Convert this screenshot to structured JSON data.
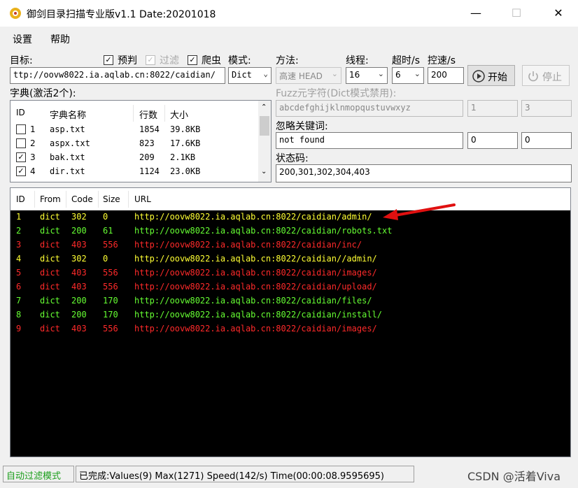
{
  "window": {
    "title": "御剑目录扫描专业版v1.1 Date:20201018",
    "minimize": "—",
    "maximize": "☐",
    "close": "✕"
  },
  "menu": [
    "设置",
    "帮助"
  ],
  "target": {
    "label": "目标:",
    "value": "ttp://oovw8022.ia.aqlab.cn:8022/caidian/"
  },
  "options": {
    "precheck": {
      "label": "预判",
      "checked": true
    },
    "filter": {
      "label": "过滤",
      "checked": true,
      "disabled": true
    },
    "crawler": {
      "label": "爬虫",
      "checked": true
    }
  },
  "mode": {
    "label": "模式:",
    "value": "Dict"
  },
  "method": {
    "label": "方法:",
    "value": "高速 HEAD"
  },
  "threads": {
    "label": "线程:",
    "value": "16"
  },
  "timeout": {
    "label": "超时/s",
    "value": "6"
  },
  "speed": {
    "label": "控速/s",
    "value": "200"
  },
  "buttons": {
    "start": "开始",
    "stop": "停止"
  },
  "dict": {
    "label": "字典(激活2个):",
    "headers": [
      "ID",
      "字典名称",
      "行数",
      "大小"
    ],
    "rows": [
      {
        "checked": false,
        "id": "1",
        "name": "asp.txt",
        "lines": "1854",
        "size": "39.8KB"
      },
      {
        "checked": false,
        "id": "2",
        "name": "aspx.txt",
        "lines": "823",
        "size": "17.6KB"
      },
      {
        "checked": true,
        "id": "3",
        "name": "bak.txt",
        "lines": "209",
        "size": "2.1KB"
      },
      {
        "checked": true,
        "id": "4",
        "name": "dir.txt",
        "lines": "1124",
        "size": "23.0KB"
      }
    ]
  },
  "fuzz": {
    "label": "Fuzz元字符(Dict模式禁用):",
    "chars": "abcdefghijklnmopqustuvwxyz",
    "min": "1",
    "max": "3"
  },
  "ignore": {
    "label": "忽略关键词:",
    "value": "not found",
    "a": "0",
    "b": "0"
  },
  "status": {
    "label": "状态码:",
    "value": "200,301,302,304,403"
  },
  "results": {
    "headers": [
      "ID",
      "From",
      "Code",
      "Size",
      "URL"
    ],
    "colors": {
      "302": "#ffff33",
      "200": "#66ff33",
      "403": "#ff2a2a"
    },
    "rows": [
      {
        "id": "1",
        "from": "dict",
        "code": "302",
        "size": "0",
        "url": "http://oovw8022.ia.aqlab.cn:8022/caidian/admin/"
      },
      {
        "id": "2",
        "from": "dict",
        "code": "200",
        "size": "61",
        "url": "http://oovw8022.ia.aqlab.cn:8022/caidian/robots.txt"
      },
      {
        "id": "3",
        "from": "dict",
        "code": "403",
        "size": "556",
        "url": "http://oovw8022.ia.aqlab.cn:8022/caidian/inc/"
      },
      {
        "id": "4",
        "from": "dict",
        "code": "302",
        "size": "0",
        "url": "http://oovw8022.ia.aqlab.cn:8022/caidian//admin/"
      },
      {
        "id": "5",
        "from": "dict",
        "code": "403",
        "size": "556",
        "url": "http://oovw8022.ia.aqlab.cn:8022/caidian/images/"
      },
      {
        "id": "6",
        "from": "dict",
        "code": "403",
        "size": "556",
        "url": "http://oovw8022.ia.aqlab.cn:8022/caidian/upload/"
      },
      {
        "id": "7",
        "from": "dict",
        "code": "200",
        "size": "170",
        "url": "http://oovw8022.ia.aqlab.cn:8022/caidian/files/"
      },
      {
        "id": "8",
        "from": "dict",
        "code": "200",
        "size": "170",
        "url": "http://oovw8022.ia.aqlab.cn:8022/caidian/install/"
      },
      {
        "id": "9",
        "from": "dict",
        "code": "403",
        "size": "556",
        "url": "http://oovw8022.ia.aqlab.cn:8022/caidian/images/"
      }
    ]
  },
  "statusbar": {
    "mode": "自动过滤模式",
    "progress": "已完成:Values(9) Max(1271) Speed(142/s) Time(00:00:08.9595695)",
    "watermark": "CSDN @活着Viva"
  }
}
